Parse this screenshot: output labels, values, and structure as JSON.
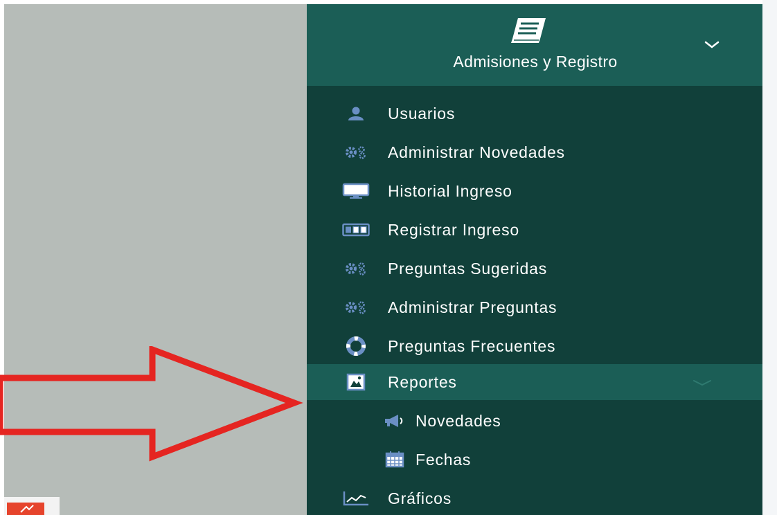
{
  "sidebar": {
    "module": {
      "title": "Admisiones y Registro",
      "icon": "book-icon",
      "expanded": true
    },
    "items": [
      {
        "label": "Usuarios",
        "icon": "user-icon"
      },
      {
        "label": "Administrar Novedades",
        "icon": "cogs-icon"
      },
      {
        "label": "Historial Ingreso",
        "icon": "desktop-icon"
      },
      {
        "label": "Registrar Ingreso",
        "icon": "id-card-icon"
      },
      {
        "label": "Preguntas Sugeridas",
        "icon": "cogs-icon"
      },
      {
        "label": "Administrar Preguntas",
        "icon": "cogs-icon"
      },
      {
        "label": "Preguntas Frecuentes",
        "icon": "life-ring-icon"
      },
      {
        "label": "Reportes",
        "icon": "picture-file-icon",
        "active": true,
        "expanded": true,
        "children": [
          {
            "label": "Novedades",
            "icon": "bullhorn-icon"
          },
          {
            "label": "Fechas",
            "icon": "calendar-icon"
          }
        ]
      },
      {
        "label": "Gráficos",
        "icon": "line-chart-icon"
      }
    ]
  },
  "annotation": {
    "shape": "arrow-right",
    "color": "#e52521"
  },
  "colors": {
    "sidebar_bg": "#11403a",
    "header_bg": "#1b5e56",
    "active_bg": "#1b5e56",
    "left_panel_bg": "#b6bcb8",
    "icon_color": "#6a8fc4"
  }
}
